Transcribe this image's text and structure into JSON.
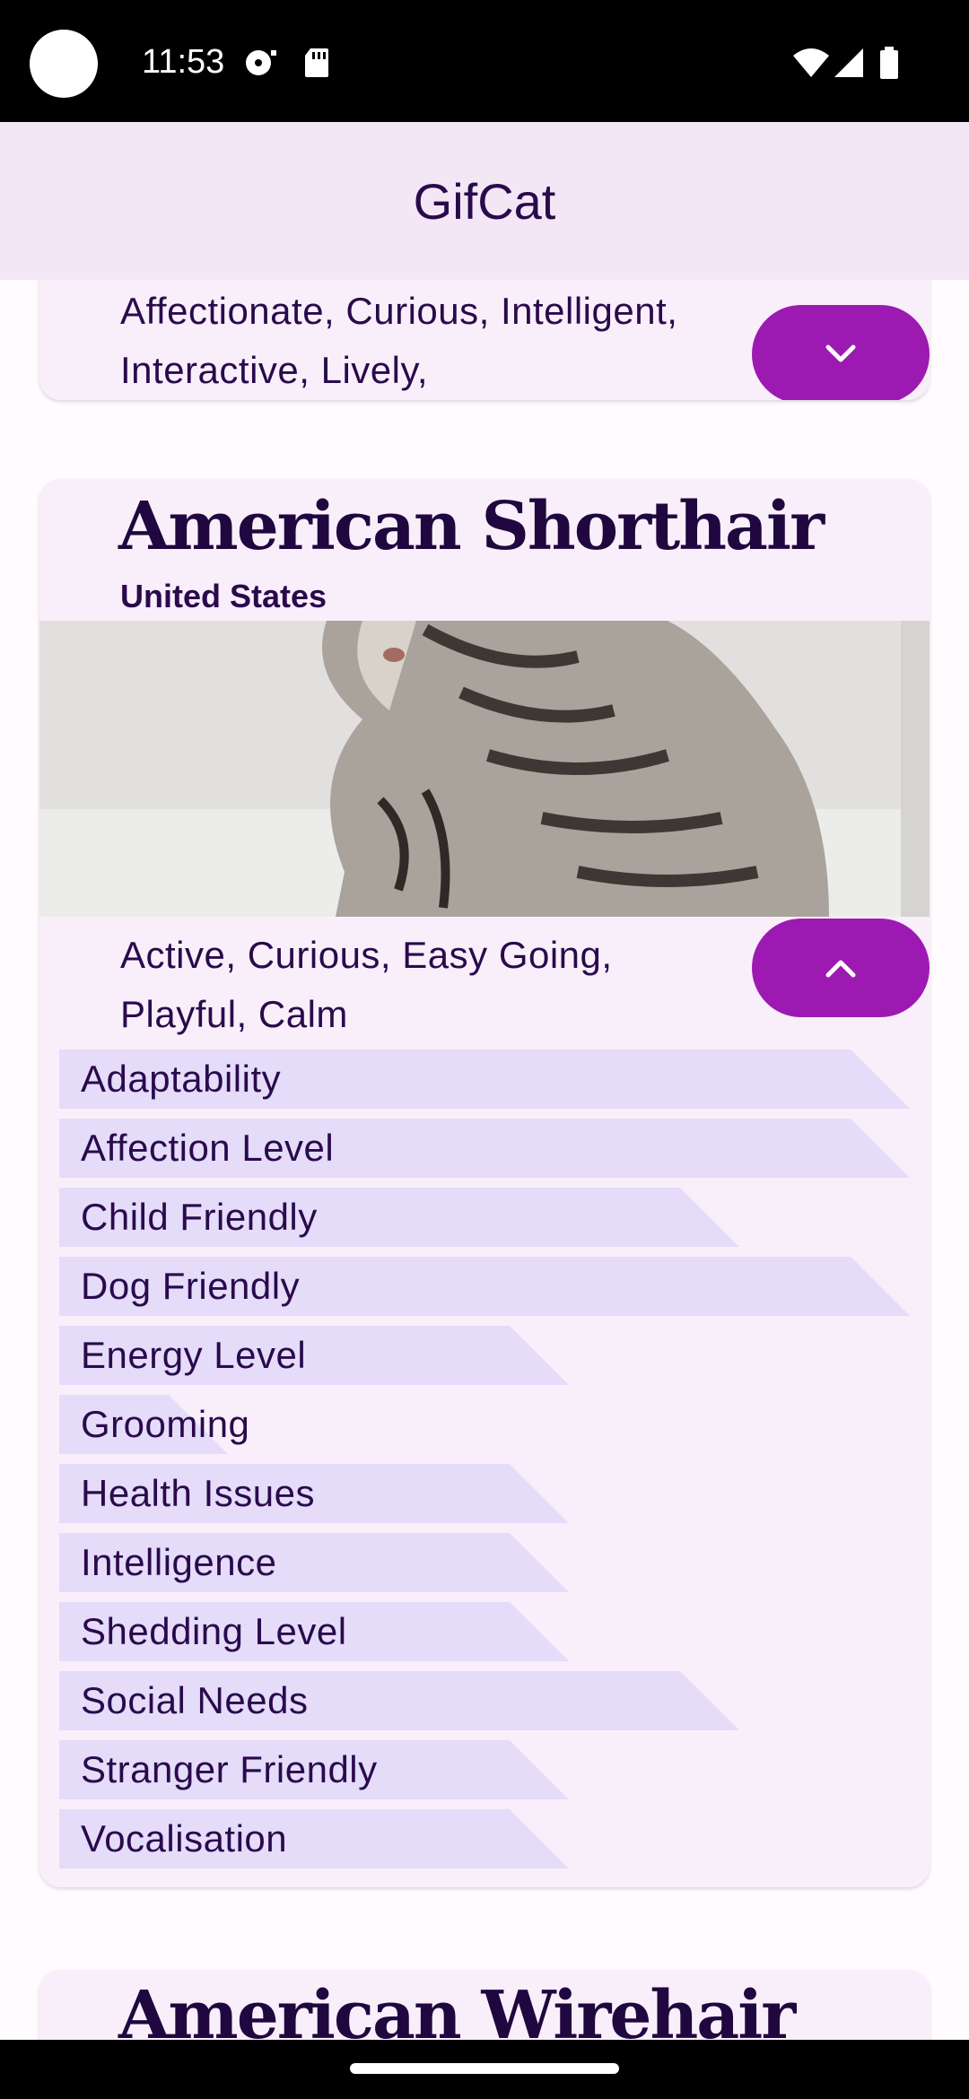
{
  "status_bar": {
    "time": "11:53",
    "icons": [
      "camera-dot",
      "media-icon",
      "sd-card-icon",
      "wifi-icon",
      "signal-icon",
      "battery-icon"
    ]
  },
  "app_bar": {
    "title": "GifCat"
  },
  "colors": {
    "app_bar_bg": "#f3e7f6",
    "card_bg": "#f9effa",
    "accent_fab": "#9c1ab1",
    "stat_bar": "#e4dcf9",
    "text_dark": "#2a0a4c"
  },
  "cards": [
    {
      "temperament": "Affectionate, Curious, Intelligent, Interactive, Lively,",
      "expand_icon": "chevron-down-icon"
    },
    {
      "name": "American Shorthair",
      "origin": "United States",
      "temperament": "Active, Curious, Easy Going, Playful, Calm",
      "collapse_icon": "chevron-up-icon",
      "stats": [
        {
          "label": "Adaptability",
          "level": 5,
          "max": 5
        },
        {
          "label": "Affection Level",
          "level": 5,
          "max": 5
        },
        {
          "label": "Child Friendly",
          "level": 4,
          "max": 5
        },
        {
          "label": "Dog Friendly",
          "level": 5,
          "max": 5
        },
        {
          "label": "Energy Level",
          "level": 3,
          "max": 5
        },
        {
          "label": "Grooming",
          "level": 1,
          "max": 5
        },
        {
          "label": "Health Issues",
          "level": 3,
          "max": 5
        },
        {
          "label": "Intelligence",
          "level": 3,
          "max": 5
        },
        {
          "label": "Shedding Level",
          "level": 3,
          "max": 5
        },
        {
          "label": "Social Needs",
          "level": 4,
          "max": 5
        },
        {
          "label": "Stranger Friendly",
          "level": 3,
          "max": 5
        },
        {
          "label": "Vocalisation",
          "level": 3,
          "max": 5
        }
      ]
    },
    {
      "name": "American Wirehair"
    }
  ]
}
